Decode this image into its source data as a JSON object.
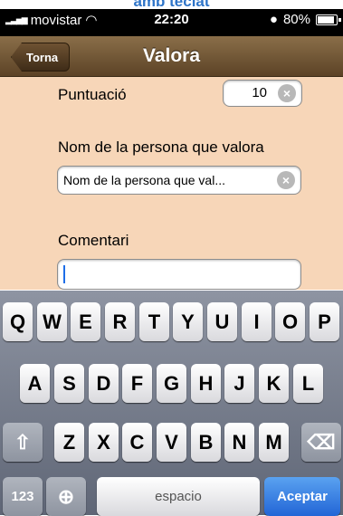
{
  "caption": "amb teclat",
  "status": {
    "carrier": "movistar",
    "time": "22:20",
    "battery": "80%"
  },
  "nav": {
    "back": "Torna",
    "title": "Valora"
  },
  "form": {
    "score_label": "Puntuació",
    "score_value": "10",
    "name_label": "Nom de la persona que valora",
    "name_placeholder": "Nom de la persona que val...",
    "comment_label": "Comentari",
    "comment_value": ""
  },
  "keyboard": {
    "row1": [
      "Q",
      "W",
      "E",
      "R",
      "T",
      "Y",
      "U",
      "I",
      "O",
      "P"
    ],
    "row2": [
      "A",
      "S",
      "D",
      "F",
      "G",
      "H",
      "J",
      "K",
      "L"
    ],
    "row3": [
      "Z",
      "X",
      "C",
      "V",
      "B",
      "N",
      "M"
    ],
    "numbers_key": "123",
    "space_key": "espacio",
    "return_key": "Aceptar"
  }
}
